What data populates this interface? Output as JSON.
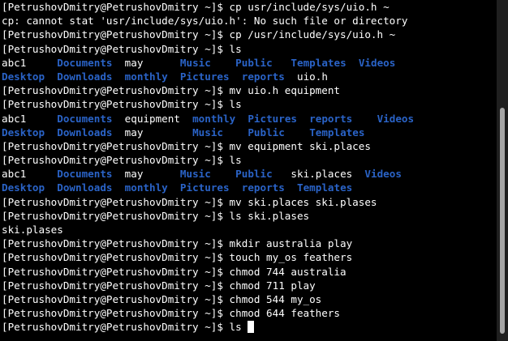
{
  "colors": {
    "background": "#000000",
    "text": "#ffffff",
    "directory": "#2a63c7",
    "scrollbar_thumb": "#a6a6a6"
  },
  "terminal": {
    "lines": [
      [
        {
          "t": "[PetrushovDmitry@PetrushovDmitry ~]$ cp usr/include/sys/uio.h ~"
        }
      ],
      [
        {
          "t": "cp: cannot stat 'usr/include/sys/uio.h': No such file or directory"
        }
      ],
      [
        {
          "t": "[PetrushovDmitry@PetrushovDmitry ~]$ cp /usr/include/sys/uio.h ~"
        }
      ],
      [
        {
          "t": "[PetrushovDmitry@PetrushovDmitry ~]$ ls"
        }
      ],
      [
        {
          "t": "abc1     "
        },
        {
          "t": "Documents",
          "d": true
        },
        {
          "t": "  may      "
        },
        {
          "t": "Music",
          "d": true
        },
        {
          "t": "    "
        },
        {
          "t": "Public",
          "d": true
        },
        {
          "t": "   "
        },
        {
          "t": "Templates",
          "d": true
        },
        {
          "t": "  "
        },
        {
          "t": "Videos",
          "d": true
        }
      ],
      [
        {
          "t": "Desktop",
          "d": true
        },
        {
          "t": "  "
        },
        {
          "t": "Downloads",
          "d": true
        },
        {
          "t": "  "
        },
        {
          "t": "monthly",
          "d": true
        },
        {
          "t": "  "
        },
        {
          "t": "Pictures",
          "d": true
        },
        {
          "t": "  "
        },
        {
          "t": "reports",
          "d": true
        },
        {
          "t": "  uio.h"
        }
      ],
      [
        {
          "t": "[PetrushovDmitry@PetrushovDmitry ~]$ mv uio.h equipment"
        }
      ],
      [
        {
          "t": "[PetrushovDmitry@PetrushovDmitry ~]$ ls"
        }
      ],
      [
        {
          "t": "abc1     "
        },
        {
          "t": "Documents",
          "d": true
        },
        {
          "t": "  equipment  "
        },
        {
          "t": "monthly",
          "d": true
        },
        {
          "t": "  "
        },
        {
          "t": "Pictures",
          "d": true
        },
        {
          "t": "  "
        },
        {
          "t": "reports",
          "d": true
        },
        {
          "t": "    "
        },
        {
          "t": "Videos",
          "d": true
        }
      ],
      [
        {
          "t": "Desktop",
          "d": true
        },
        {
          "t": "  "
        },
        {
          "t": "Downloads",
          "d": true
        },
        {
          "t": "  may        "
        },
        {
          "t": "Music",
          "d": true
        },
        {
          "t": "    "
        },
        {
          "t": "Public",
          "d": true
        },
        {
          "t": "    "
        },
        {
          "t": "Templates",
          "d": true
        }
      ],
      [
        {
          "t": "[PetrushovDmitry@PetrushovDmitry ~]$ mv equipment ski.places"
        }
      ],
      [
        {
          "t": "[PetrushovDmitry@PetrushovDmitry ~]$ ls"
        }
      ],
      [
        {
          "t": "abc1     "
        },
        {
          "t": "Documents",
          "d": true
        },
        {
          "t": "  may      "
        },
        {
          "t": "Music",
          "d": true
        },
        {
          "t": "    "
        },
        {
          "t": "Public",
          "d": true
        },
        {
          "t": "   ski.places  "
        },
        {
          "t": "Videos",
          "d": true
        }
      ],
      [
        {
          "t": "Desktop",
          "d": true
        },
        {
          "t": "  "
        },
        {
          "t": "Downloads",
          "d": true
        },
        {
          "t": "  "
        },
        {
          "t": "monthly",
          "d": true
        },
        {
          "t": "  "
        },
        {
          "t": "Pictures",
          "d": true
        },
        {
          "t": "  "
        },
        {
          "t": "reports",
          "d": true
        },
        {
          "t": "  "
        },
        {
          "t": "Templates",
          "d": true
        }
      ],
      [
        {
          "t": "[PetrushovDmitry@PetrushovDmitry ~]$ mv ski.places ski.plases"
        }
      ],
      [
        {
          "t": "[PetrushovDmitry@PetrushovDmitry ~]$ ls ski.plases"
        }
      ],
      [
        {
          "t": "ski.plases"
        }
      ],
      [
        {
          "t": "[PetrushovDmitry@PetrushovDmitry ~]$ mkdir australia play"
        }
      ],
      [
        {
          "t": "[PetrushovDmitry@PetrushovDmitry ~]$ touch my_os feathers"
        }
      ],
      [
        {
          "t": "[PetrushovDmitry@PetrushovDmitry ~]$ chmod 744 australia"
        }
      ],
      [
        {
          "t": "[PetrushovDmitry@PetrushovDmitry ~]$ chmod 711 play"
        }
      ],
      [
        {
          "t": "[PetrushovDmitry@PetrushovDmitry ~]$ chmod 544 my_os"
        }
      ],
      [
        {
          "t": "[PetrushovDmitry@PetrushovDmitry ~]$ chmod 644 feathers"
        }
      ],
      [
        {
          "t": "[PetrushovDmitry@PetrushovDmitry ~]$ ls "
        }
      ]
    ]
  }
}
